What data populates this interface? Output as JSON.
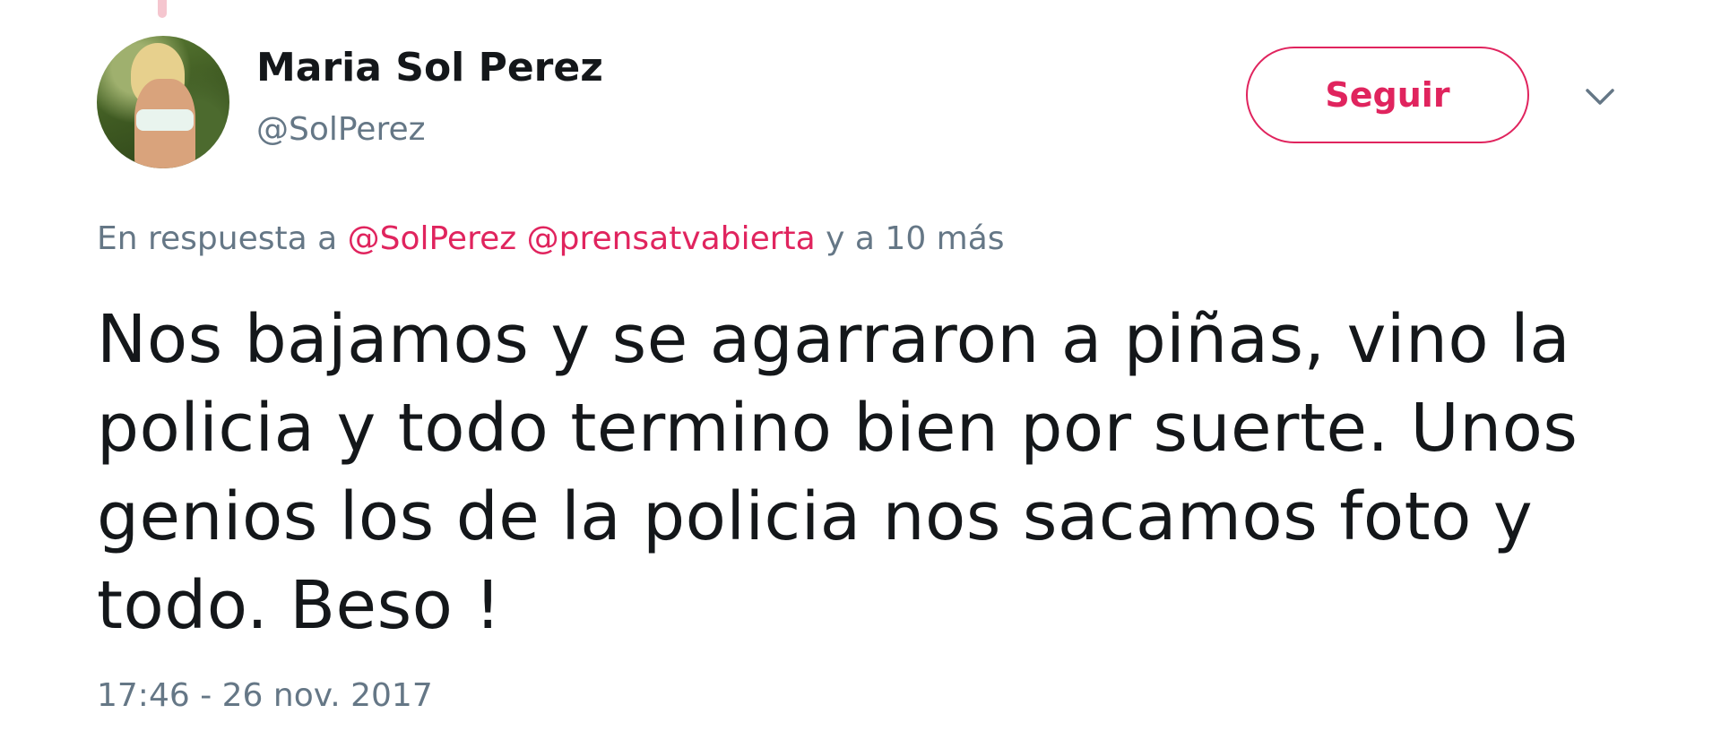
{
  "author": {
    "name": "Maria Sol Perez",
    "handle": "@SolPerez"
  },
  "follow_button": {
    "label": "Seguir"
  },
  "colors": {
    "accent": "#e0245e",
    "muted": "#657786",
    "text": "#14171a"
  },
  "reply_context": {
    "prefix": "En respuesta a",
    "mentions": [
      "@SolPerez",
      "@prensatvabierta"
    ],
    "suffix": "y a 10 más"
  },
  "tweet": {
    "text": "Nos bajamos y se agarraron a piñas, vino la policia y todo termino bien por suerte. Unos genios los de la policia nos sacamos foto y todo. Beso !",
    "timestamp": "17:46 - 26 nov. 2017"
  },
  "icons": {
    "avatar": "profile-photo",
    "menu": "chevron-down-icon"
  }
}
